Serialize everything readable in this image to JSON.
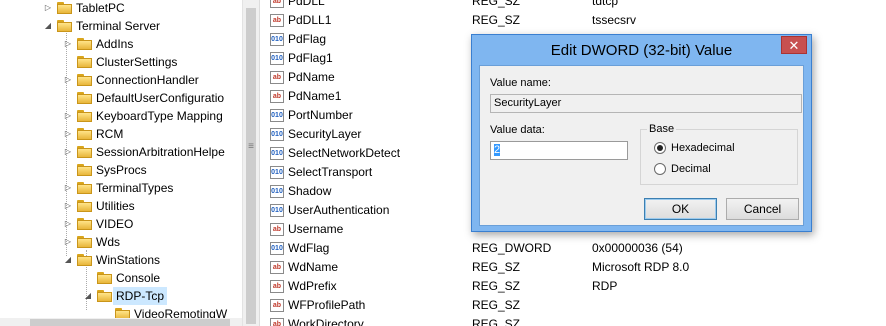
{
  "tree": {
    "items": [
      {
        "label": "TabletPC",
        "expander": "▷"
      },
      {
        "label": "Terminal Server",
        "expander": "◢"
      },
      {
        "label": "AddIns",
        "expander": "▷"
      },
      {
        "label": "ClusterSettings",
        "expander": ""
      },
      {
        "label": "ConnectionHandler",
        "expander": "▷"
      },
      {
        "label": "DefaultUserConfiguratio",
        "expander": ""
      },
      {
        "label": "KeyboardType Mapping",
        "expander": "▷"
      },
      {
        "label": "RCM",
        "expander": "▷"
      },
      {
        "label": "SessionArbitrationHelpe",
        "expander": "▷"
      },
      {
        "label": "SysProcs",
        "expander": ""
      },
      {
        "label": "TerminalTypes",
        "expander": "▷"
      },
      {
        "label": "Utilities",
        "expander": "▷"
      },
      {
        "label": "VIDEO",
        "expander": "▷"
      },
      {
        "label": "Wds",
        "expander": "▷"
      },
      {
        "label": "WinStations",
        "expander": "◢"
      },
      {
        "label": "Console",
        "expander": ""
      },
      {
        "label": "RDP-Tcp",
        "expander": "◢"
      },
      {
        "label": "VideoRemotingW",
        "expander": ""
      }
    ]
  },
  "values": {
    "rows": [
      {
        "name": "PdDLL",
        "type": "REG_SZ",
        "data": "tdtcp",
        "icon": "ab"
      },
      {
        "name": "PdDLL1",
        "type": "REG_SZ",
        "data": "tssecsrv",
        "icon": "ab"
      },
      {
        "name": "PdFlag",
        "type": "",
        "data": "",
        "icon": "010"
      },
      {
        "name": "PdFlag1",
        "type": "",
        "data": "",
        "icon": "010"
      },
      {
        "name": "PdName",
        "type": "",
        "data": "",
        "icon": "ab"
      },
      {
        "name": "PdName1",
        "type": "",
        "data": "",
        "icon": "ab"
      },
      {
        "name": "PortNumber",
        "type": "",
        "data": "",
        "icon": "010"
      },
      {
        "name": "SecurityLayer",
        "type": "",
        "data": "",
        "icon": "010"
      },
      {
        "name": "SelectNetworkDetect",
        "type": "",
        "data": "",
        "icon": "010"
      },
      {
        "name": "SelectTransport",
        "type": "",
        "data": "",
        "icon": "010"
      },
      {
        "name": "Shadow",
        "type": "",
        "data": "",
        "icon": "010"
      },
      {
        "name": "UserAuthentication",
        "type": "",
        "data": "",
        "icon": "010"
      },
      {
        "name": "Username",
        "type": "",
        "data": "",
        "icon": "ab"
      },
      {
        "name": "WdFlag",
        "type": "REG_DWORD",
        "data": "0x00000036 (54)",
        "icon": "010"
      },
      {
        "name": "WdName",
        "type": "REG_SZ",
        "data": "Microsoft RDP 8.0",
        "icon": "ab"
      },
      {
        "name": "WdPrefix",
        "type": "REG_SZ",
        "data": "RDP",
        "icon": "ab"
      },
      {
        "name": "WFProfilePath",
        "type": "REG_SZ",
        "data": "",
        "icon": "ab"
      },
      {
        "name": "WorkDirectory",
        "type": "REG_SZ",
        "data": "",
        "icon": "ab"
      }
    ]
  },
  "dialog": {
    "title": "Edit DWORD (32-bit) Value",
    "close_label": "✕",
    "value_name_label": "Value name:",
    "value_name": "SecurityLayer",
    "value_data_label": "Value data:",
    "value_data": "2",
    "base_label": "Base",
    "hex_label": "Hexadecimal",
    "dec_label": "Decimal",
    "base_selected": "Hexadecimal",
    "ok_label": "OK",
    "cancel_label": "Cancel"
  },
  "splitter_grip": "≡"
}
